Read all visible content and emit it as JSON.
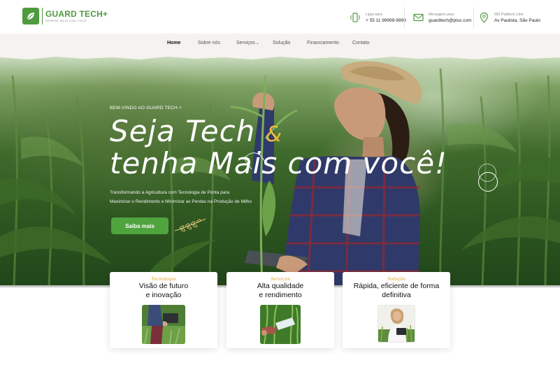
{
  "brand": {
    "name": "GUARD TECH+",
    "tagline": "SEMPRE MAIS COM VOCÊ"
  },
  "contacts": [
    {
      "icon": "phone-icon",
      "label": "Ligue para",
      "value": "+ 55 11 99999-9999"
    },
    {
      "icon": "mail-icon",
      "label": "Mensagem para",
      "value": "guardtech@plus.com"
    },
    {
      "icon": "location-pin-icon",
      "label": "555 Paddock Lobo",
      "value": "Av Paulista, São Paulo"
    }
  ],
  "nav": {
    "items": [
      "Home",
      "Sobre nós",
      "Serviços",
      "Solução",
      "Financiamento",
      "Contato"
    ],
    "active": "Home"
  },
  "hero": {
    "eyebrow": "BEM-VINDO AO GUARD TECH +",
    "title_line1": "Seja Tech",
    "title_amp": "&",
    "title_line2": "tenha Mais com você!",
    "subtitle_line1": "Transformando a Agricultura com Tecnologia de Ponta para",
    "subtitle_line2": "Maximizar o Rendimento e Minimizar as Perdas na Produção de Milho",
    "cta_label": "Saiba mais"
  },
  "cards": [
    {
      "tag": "Tecnologia",
      "title_line1": "Visão de futuro",
      "title_line2": "e inovação",
      "image": "farmer-with-tablet-in-field"
    },
    {
      "tag": "Serviços",
      "title_line1": "Alta qualidade",
      "title_line2": "e rendimento",
      "image": "hand-scanning-crops"
    },
    {
      "tag": "Solução",
      "title_line1": "Rápida, eficiente de forma",
      "title_line2": "definitiva",
      "image": "woman-with-tablet-in-field"
    }
  ],
  "colors": {
    "brand_green": "#4f9a3e",
    "accent_gold": "#e0a12a",
    "button_green": "#4fa43e",
    "nav_background": "#f5f3ef"
  }
}
